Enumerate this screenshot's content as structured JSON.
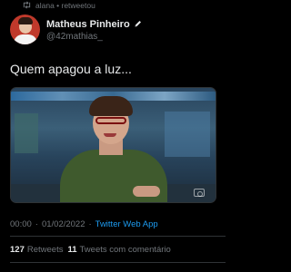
{
  "retweet": {
    "text": "alana • retweetou",
    "icon": "retweet-icon"
  },
  "author": {
    "display_name": "Matheus Pinheiro",
    "handle": "@42mathias_",
    "badge_icon": "pencil-icon"
  },
  "tweet": {
    "text": "Quem apagou a luz..."
  },
  "media": {
    "description_icon": "video-watermark-icon"
  },
  "meta": {
    "time": "00:00",
    "separator1": "·",
    "date": "01/02/2022",
    "separator2": "·",
    "source": "Twitter Web App"
  },
  "stats": {
    "retweets_count": "127",
    "retweets_label": "Retweets",
    "quotes_count": "11",
    "quotes_label": "Tweets com comentário"
  },
  "colors": {
    "background": "#000000",
    "text": "#e7e9ea",
    "muted": "#71767b",
    "link": "#1d9bf0"
  }
}
